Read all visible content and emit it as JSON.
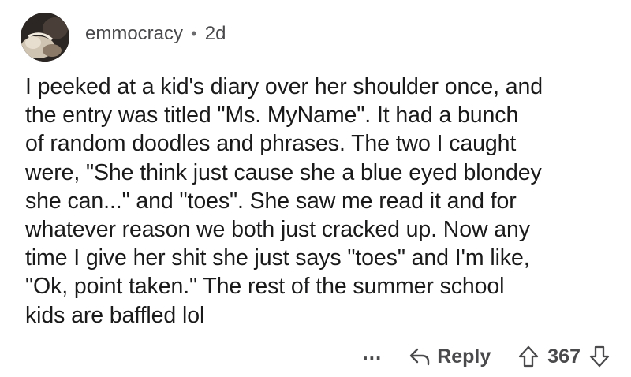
{
  "comment": {
    "author": "emmocracy",
    "separator": "•",
    "age": "2d",
    "body": "I peeked at a kid's diary over her shoulder once, and\nthe entry was titled \"Ms. MyName\". It had a bunch\nof random doodles and phrases. The two I caught\nwere, \"She think just cause she a blue eyed blondey\nshe can...\" and \"toes\". She saw me read it and for\nwhatever reason we both just cracked up. Now any\ntime I give her shit she just says \"toes\" and I'm like,\n\"Ok, point taken.\" The rest of the summer school\nkids are baffled lol"
  },
  "actions": {
    "more_label": "...",
    "reply_label": "Reply",
    "score": "367",
    "icons": {
      "more": "more-dots-icon",
      "reply": "reply-arrow-icon",
      "upvote": "upvote-arrow-icon",
      "downvote": "downvote-arrow-icon"
    }
  },
  "colors": {
    "text": "#1a1a1b",
    "meta": "#4a4a4c",
    "background": "#ffffff"
  }
}
